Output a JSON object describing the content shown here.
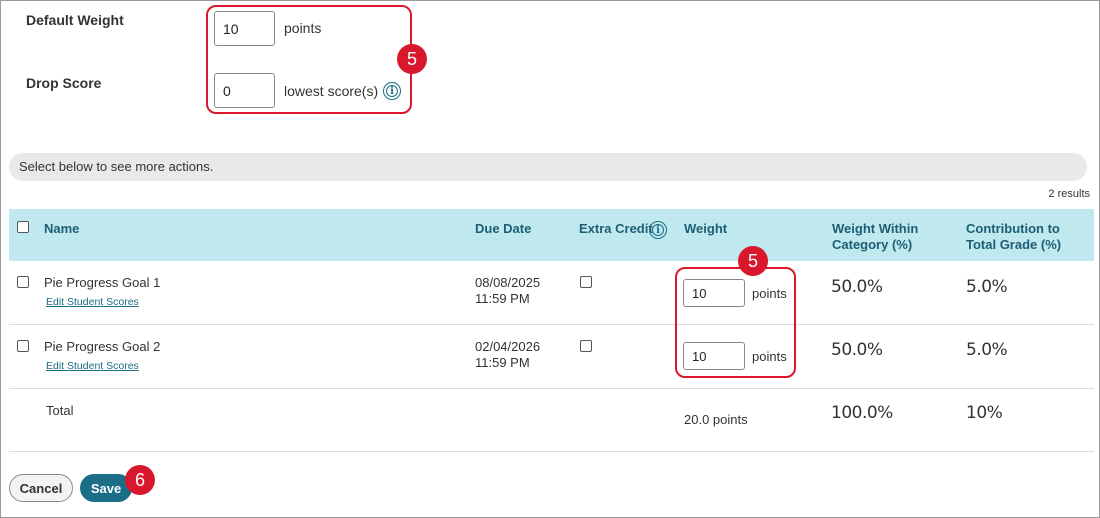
{
  "settings": {
    "default_weight_label": "Default Weight",
    "default_weight_value": "10",
    "default_weight_unit": "points",
    "drop_score_label": "Drop Score",
    "drop_score_value": "0",
    "drop_score_unit": "lowest score(s)",
    "callout": "5"
  },
  "actions_bar": {
    "text": "Select below to see more actions."
  },
  "results": "2 results",
  "table": {
    "columns": {
      "name": "Name",
      "due_date": "Due Date",
      "extra_credit": "Extra Credit",
      "weight": "Weight",
      "weight_within": "Weight Within Category (%)",
      "contribution": "Contribution to Total Grade (%)"
    },
    "weight_callout": "5",
    "rows": [
      {
        "name": "Pie Progress Goal 1",
        "link": "Edit Student Scores",
        "date": "08/08/2025",
        "time": "11:59 PM",
        "weight": "10",
        "unit": "points",
        "within": "50.0%",
        "contribution": "5.0%"
      },
      {
        "name": "Pie Progress Goal 2",
        "link": "Edit Student Scores",
        "date": "02/04/2026",
        "time": "11:59 PM",
        "weight": "10",
        "unit": "points",
        "within": "50.0%",
        "contribution": "5.0%"
      }
    ],
    "total": {
      "label": "Total",
      "weight": "20.0 points",
      "within": "100.0%",
      "contribution": "10%"
    }
  },
  "buttons": {
    "cancel": "Cancel",
    "save": "Save",
    "save_callout": "6"
  },
  "colors": {
    "accent": "#1a6e85",
    "callout": "#d9182d",
    "header_bg": "#bfe8ef"
  }
}
